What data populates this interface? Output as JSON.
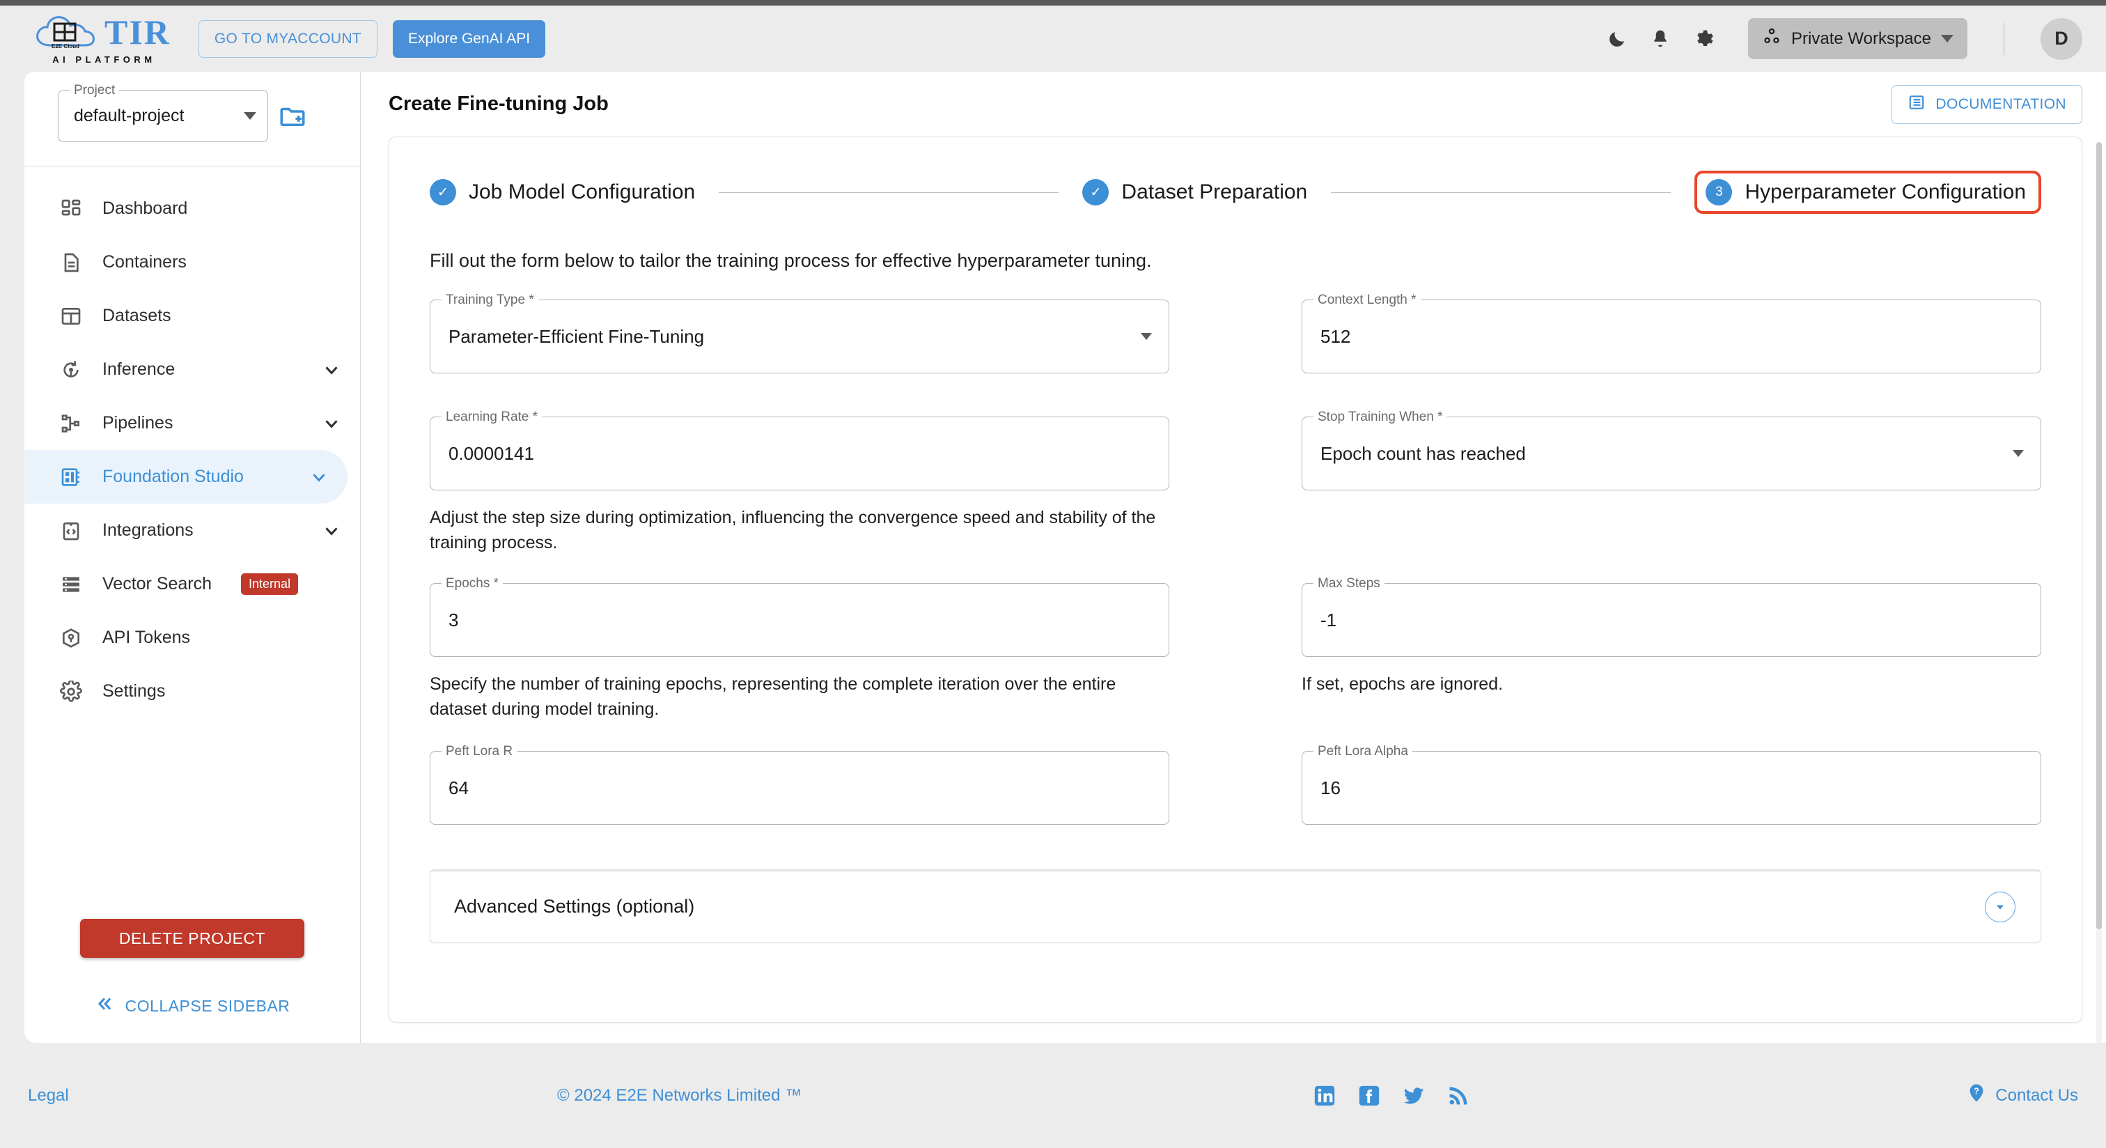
{
  "header": {
    "logo": {
      "brand": "TIR",
      "subtitle": "AI PLATFORM",
      "cloud_text": "E2E Cloud"
    },
    "myaccount_label": "GO TO MYACCOUNT",
    "genai_label": "Explore GenAI API",
    "icons": [
      "dark-mode-icon",
      "notifications-icon",
      "settings-gear-icon"
    ],
    "workspace_label": "Private Workspace",
    "avatar_initial": "D"
  },
  "sidebar": {
    "project_label": "Project",
    "project_value": "default-project",
    "new_project_icon": "folder-add-icon",
    "items": [
      {
        "label": "Dashboard",
        "icon": "dashboard-grid-icon",
        "chevron": false,
        "active": false,
        "badge": ""
      },
      {
        "label": "Containers",
        "icon": "document-icon",
        "chevron": false,
        "active": false,
        "badge": ""
      },
      {
        "label": "Datasets",
        "icon": "table-grid-icon",
        "chevron": false,
        "active": false,
        "badge": ""
      },
      {
        "label": "Inference",
        "icon": "inference-icon",
        "chevron": true,
        "active": false,
        "badge": ""
      },
      {
        "label": "Pipelines",
        "icon": "pipeline-nodes-icon",
        "chevron": true,
        "active": false,
        "badge": ""
      },
      {
        "label": "Foundation Studio",
        "icon": "foundation-studio-icon",
        "chevron": true,
        "active": true,
        "badge": ""
      },
      {
        "label": "Integrations",
        "icon": "code-clipboard-icon",
        "chevron": true,
        "active": false,
        "badge": ""
      },
      {
        "label": "Vector Search",
        "icon": "database-list-icon",
        "chevron": false,
        "active": false,
        "badge": "Internal"
      },
      {
        "label": "API Tokens",
        "icon": "cube-key-icon",
        "chevron": false,
        "active": false,
        "badge": ""
      },
      {
        "label": "Settings",
        "icon": "gear-icon",
        "chevron": false,
        "active": false,
        "badge": ""
      }
    ],
    "delete_project_label": "DELETE PROJECT",
    "collapse_label": "COLLAPSE SIDEBAR"
  },
  "page": {
    "title": "Create Fine-tuning Job",
    "documentation_label": "DOCUMENTATION"
  },
  "stepper": {
    "steps": [
      {
        "marker": "✓",
        "label": "Job Model Configuration",
        "state": "complete",
        "highlighted": false
      },
      {
        "marker": "✓",
        "label": "Dataset Preparation",
        "state": "complete",
        "highlighted": false
      },
      {
        "marker": "3",
        "label": "Hyperparameter Configuration",
        "state": "current",
        "highlighted": true
      }
    ],
    "highlight_color": "#e8452a",
    "accent_color": "#3d8fd6"
  },
  "form": {
    "intro": "Fill out the form below to tailor the training process for effective hyperparameter tuning.",
    "fields": {
      "training_type": {
        "label": "Training Type *",
        "value": "Parameter-Efficient Fine-Tuning",
        "type": "select",
        "helper": ""
      },
      "context_length": {
        "label": "Context Length *",
        "value": "512",
        "type": "text",
        "helper": ""
      },
      "learning_rate": {
        "label": "Learning Rate *",
        "value": "0.0000141",
        "type": "text",
        "helper": "Adjust the step size during optimization, influencing the convergence speed and stability of the training process."
      },
      "stop_training_when": {
        "label": "Stop Training When *",
        "value": "Epoch count has reached",
        "type": "select",
        "helper": ""
      },
      "epochs": {
        "label": "Epochs *",
        "value": "3",
        "type": "text",
        "helper": "Specify the number of training epochs, representing the complete iteration over the entire dataset during model training."
      },
      "max_steps": {
        "label": "Max Steps",
        "value": "-1",
        "type": "text",
        "helper": "If set, epochs are ignored."
      },
      "peft_lora_r": {
        "label": "Peft Lora R",
        "value": "64",
        "type": "text",
        "helper": ""
      },
      "peft_lora_alpha": {
        "label": "Peft Lora Alpha",
        "value": "16",
        "type": "text",
        "helper": ""
      }
    },
    "advanced_settings_label": "Advanced Settings (optional)"
  },
  "footer": {
    "legal": "Legal",
    "copyright": "© 2024 E2E Networks Limited ™",
    "social": [
      "linkedin-icon",
      "facebook-icon",
      "twitter-icon",
      "rss-icon"
    ],
    "contact": "Contact Us"
  }
}
